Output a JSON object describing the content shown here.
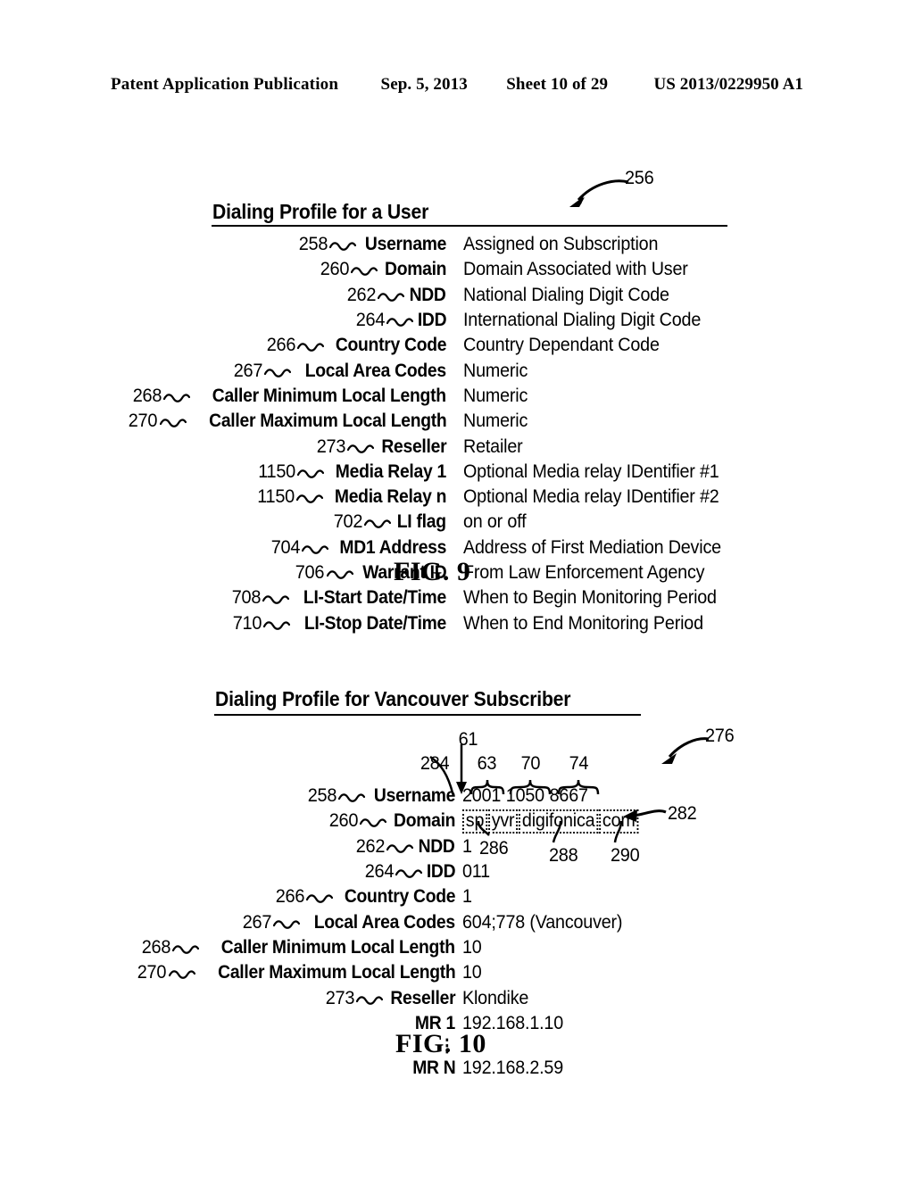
{
  "header": {
    "publication": "Patent Application Publication",
    "date": "Sep. 5, 2013",
    "sheet": "Sheet 10 of 29",
    "doc_number": "US 2013/0229950 A1"
  },
  "figure9": {
    "title": "Dialing Profile for a User",
    "caption": "FIG. 9",
    "callout": "256",
    "rows": [
      {
        "ref": "258",
        "label": "Username",
        "desc": "Assigned on Subscription"
      },
      {
        "ref": "260",
        "label": "Domain",
        "desc": "Domain Associated with User"
      },
      {
        "ref": "262",
        "label": "NDD",
        "desc": "National Dialing Digit Code"
      },
      {
        "ref": "264",
        "label": "IDD",
        "desc": "International Dialing Digit Code"
      },
      {
        "ref": "266",
        "label": "Country Code",
        "desc": "Country Dependant Code"
      },
      {
        "ref": "267",
        "label": "Local Area Codes",
        "desc": "Numeric"
      },
      {
        "ref": "268",
        "label": "Caller Minimum Local Length",
        "desc": "Numeric"
      },
      {
        "ref": "270",
        "label": "Caller Maximum Local Length",
        "desc": "Numeric"
      },
      {
        "ref": "273",
        "label": "Reseller",
        "desc": "Retailer"
      },
      {
        "ref": "1150",
        "label": "Media Relay 1",
        "desc": "Optional Media relay IDentifier #1"
      },
      {
        "ref": "1150",
        "label": "Media Relay n",
        "desc": "Optional Media relay IDentifier #2"
      },
      {
        "ref": "702",
        "label": "LI flag",
        "desc": "on or off"
      },
      {
        "ref": "704",
        "label": "MD1 Address",
        "desc": "Address of First Mediation Device"
      },
      {
        "ref": "706",
        "label": "Warrant ID",
        "desc": "From Law Enforcement Agency"
      },
      {
        "ref": "708",
        "label": "LI-Start Date/Time",
        "desc": "When to Begin Monitoring Period"
      },
      {
        "ref": "710",
        "label": "LI-Stop Date/Time",
        "desc": "When to End Monitoring Period"
      }
    ]
  },
  "figure10": {
    "title": "Dialing Profile for Vancouver Subscriber",
    "caption": "FIG. 10",
    "callout": "276",
    "username_callouts": {
      "left": "284",
      "pointer": "61",
      "segments": [
        "63",
        "70",
        "74"
      ]
    },
    "domain_callout": "282",
    "domain_segment_callouts": [
      "286",
      "288",
      "290"
    ],
    "username_parts": [
      "2001",
      "1050",
      "8667"
    ],
    "domain_parts": [
      "sp",
      "yvr",
      "digifonica",
      "com"
    ],
    "rows": [
      {
        "ref": "258",
        "label": "Username",
        "value": "2001 1050 8667"
      },
      {
        "ref": "260",
        "label": "Domain",
        "value": "sp.yvr.digifonica.com"
      },
      {
        "ref": "262",
        "label": "NDD",
        "value": "1"
      },
      {
        "ref": "264",
        "label": "IDD",
        "value": "011"
      },
      {
        "ref": "266",
        "label": "Country Code",
        "value": "1"
      },
      {
        "ref": "267",
        "label": "Local Area Codes",
        "value": "604;778 (Vancouver)"
      },
      {
        "ref": "268",
        "label": "Caller Minimum Local Length",
        "value": "10"
      },
      {
        "ref": "270",
        "label": "Caller Maximum Local Length",
        "value": "10"
      },
      {
        "ref": "273",
        "label": "Reseller",
        "value": "Klondike"
      },
      {
        "ref": "",
        "label": "MR 1",
        "value": "192.168.1.10"
      },
      {
        "ref": "",
        "label": "⋮",
        "value": ""
      },
      {
        "ref": "",
        "label": "MR N",
        "value": "192.168.2.59"
      }
    ]
  }
}
